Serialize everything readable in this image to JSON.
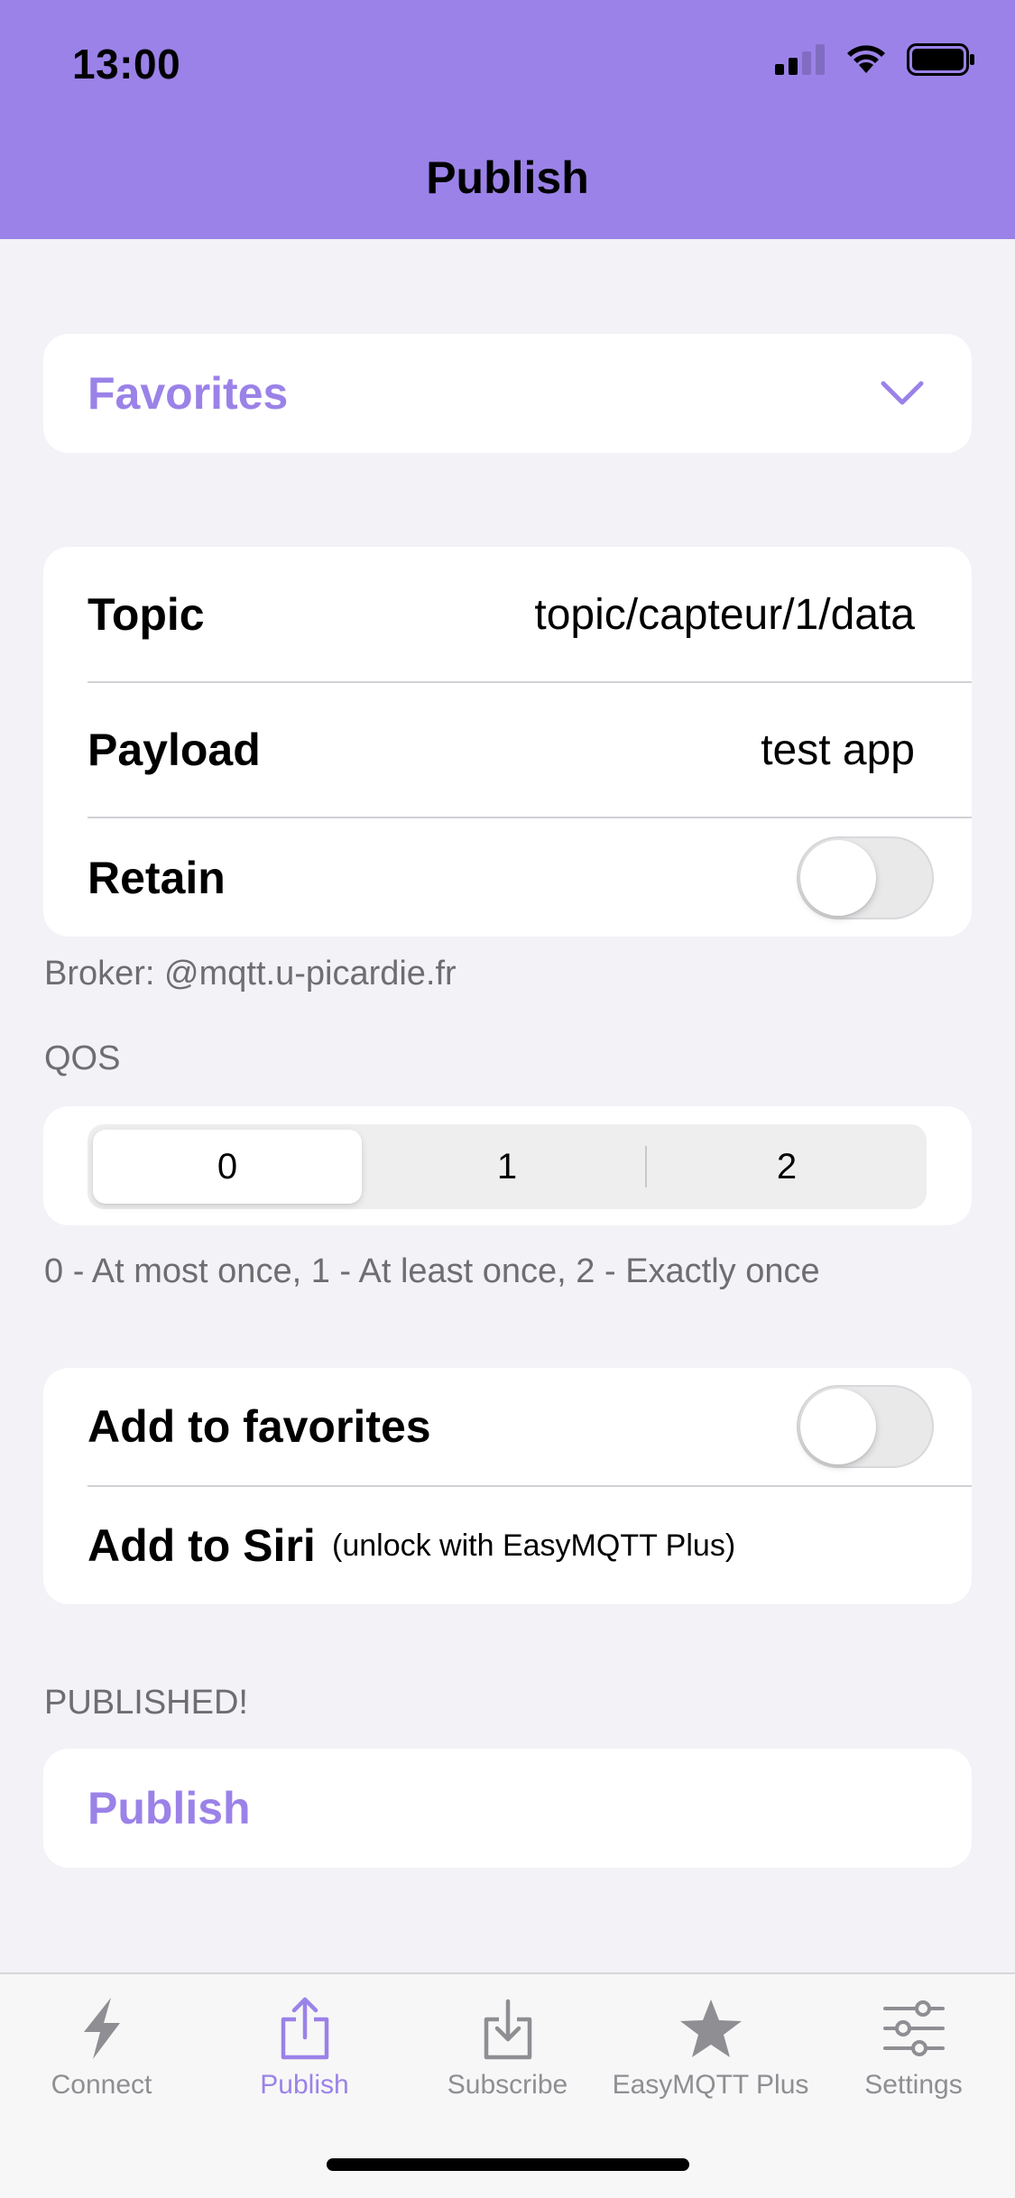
{
  "status": {
    "time": "13:00"
  },
  "nav": {
    "title": "Publish"
  },
  "favorites": {
    "label": "Favorites"
  },
  "form": {
    "topic_label": "Topic",
    "topic_value": "topic/capteur/1/data",
    "payload_label": "Payload",
    "payload_value": "test app",
    "retain_label": "Retain",
    "retain_on": false
  },
  "broker_text": "Broker: @mqtt.u-picardie.fr",
  "qos": {
    "header": "QOS",
    "options": [
      "0",
      "1",
      "2"
    ],
    "selected": "0",
    "footer": "0 - At most once, 1 - At least once, 2 - Exactly once"
  },
  "extras": {
    "favorites_label": "Add to favorites",
    "favorites_on": false,
    "siri_label": "Add to Siri",
    "siri_note": "(unlock with EasyMQTT Plus)"
  },
  "status_text": "PUBLISHED!",
  "publish_button": "Publish",
  "tabs": [
    {
      "label": "Connect",
      "icon": "bolt-icon",
      "active": false
    },
    {
      "label": "Publish",
      "icon": "share-icon",
      "active": true
    },
    {
      "label": "Subscribe",
      "icon": "download-icon",
      "active": false
    },
    {
      "label": "EasyMQTT Plus",
      "icon": "star-icon",
      "active": false
    },
    {
      "label": "Settings",
      "icon": "sliders-icon",
      "active": false
    }
  ],
  "colors": {
    "accent": "#9B82E8",
    "background": "#F2F2F7",
    "inactive": "#8E8E93"
  }
}
